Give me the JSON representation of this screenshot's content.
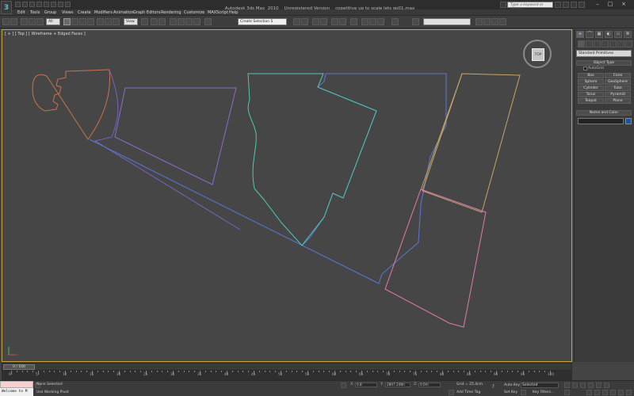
{
  "title": {
    "app": "Autodesk 3ds Max  2010",
    "status": "Unregistered Version",
    "file": "copetitive up to scale lets go01.max",
    "search_placeholder": "Type a keyword or phrase",
    "logo": "3"
  },
  "menu": [
    "Edit",
    "Tools",
    "Group",
    "Views",
    "Create",
    "Modifiers",
    "Animation",
    "Graph Editors",
    "Rendering",
    "Customize",
    "MAXScript",
    "Help"
  ],
  "toolbar": {
    "selection_filter": "All",
    "view_dropdown": "View",
    "named_selection_placeholder": "Create Selection S"
  },
  "viewport": {
    "label": "[ + ] [ Top ] [ Wireframe + Edged Faces ]",
    "viewcube_face": "TOP",
    "border_color": "#c9a13b",
    "background": "#464646",
    "shapes": [
      {
        "name": "shape-orange-curved",
        "color": "#c8734a"
      },
      {
        "name": "shape-purple-upper",
        "color": "#8c6cd0"
      },
      {
        "name": "shape-purple-lower",
        "color": "#7a62c0"
      },
      {
        "name": "shape-teal-center",
        "color": "#4ec9b4"
      },
      {
        "name": "shape-blue-right",
        "color": "#5a78d8"
      },
      {
        "name": "shape-tan-right",
        "color": "#c5a56a"
      },
      {
        "name": "shape-pink-bottom",
        "color": "#e07ab0"
      }
    ]
  },
  "command_panel": {
    "tabs": [
      "+",
      "⌒",
      "▦",
      "◐",
      "▭",
      "⚒"
    ],
    "category_icons": [
      "geometry-icon",
      "shapes-icon",
      "lights-icon",
      "cameras-icon",
      "helpers-icon",
      "spacewarps-icon",
      "systems-icon"
    ],
    "primitive_dropdown": "Standard Primitives",
    "object_type_title": "Object Type",
    "autogrid_label": "AutoGrid",
    "buttons": [
      "Box",
      "Cone",
      "Sphere",
      "GeoSphere",
      "Cylinder",
      "Tube",
      "Torus",
      "Pyramid",
      "Teapot",
      "Plane"
    ],
    "name_color_title": "Name and Color",
    "object_color": "#1555b0"
  },
  "timeline": {
    "frame_indicator": "0 / 100",
    "ticks": [
      "0",
      "5",
      "10",
      "15",
      "20",
      "25",
      "30",
      "35",
      "40",
      "45",
      "50",
      "55",
      "60",
      "65",
      "70",
      "75",
      "80",
      "85",
      "90",
      "95",
      "100"
    ]
  },
  "status": {
    "maxscript_text": "Welcome to M",
    "selection_text": "None Selected",
    "prompt_text": "Use Working Pivot",
    "x_label": "X:",
    "x_value": "0.8",
    "y_label": "Y:",
    "y_value": "2807.248n",
    "z_label": "Z:",
    "z_value": "0.0m",
    "grid_text": "Grid = 25.4cm",
    "add_time_tag": "Add Time Tag",
    "auto_key": "Auto Key",
    "selected_dropdown": "Selected",
    "set_key": "Set Key",
    "key_filters": "Key Filters..."
  }
}
